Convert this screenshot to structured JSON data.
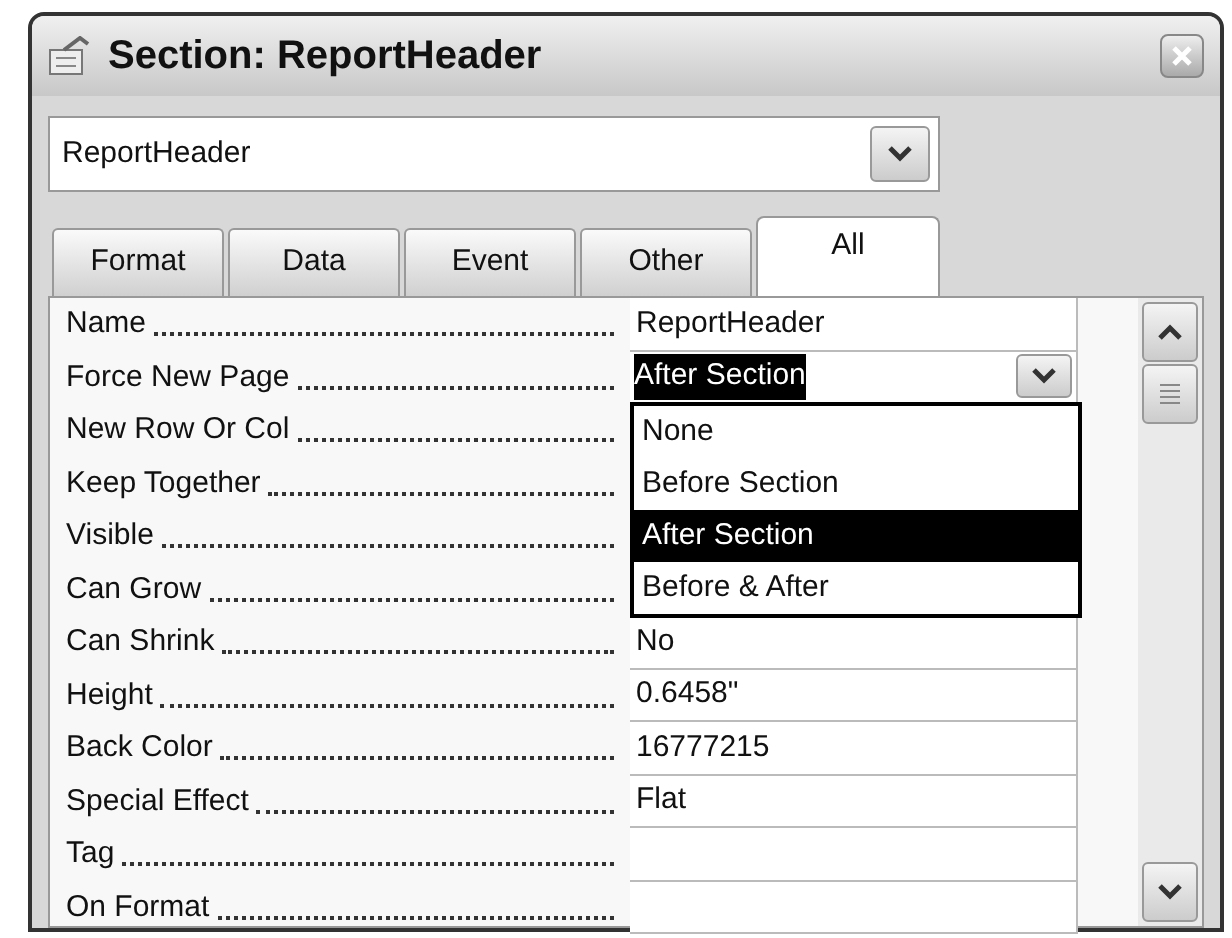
{
  "window": {
    "title": "Section: ReportHeader"
  },
  "object_selector": {
    "value": "ReportHeader"
  },
  "tabs": [
    {
      "label": "Format",
      "selected": false
    },
    {
      "label": "Data",
      "selected": false
    },
    {
      "label": "Event",
      "selected": false
    },
    {
      "label": "Other",
      "selected": false
    },
    {
      "label": "All",
      "selected": true
    }
  ],
  "properties": [
    {
      "label": "Name",
      "kind": "text",
      "value": "ReportHeader"
    },
    {
      "label": "Force New Page",
      "kind": "dropdown",
      "value": "After Section",
      "options": [
        {
          "label": "None",
          "selected": false
        },
        {
          "label": "Before Section",
          "selected": false
        },
        {
          "label": "After Section",
          "selected": true
        },
        {
          "label": "Before & After",
          "selected": false
        }
      ]
    },
    {
      "label": "New Row Or Col",
      "kind": "covered"
    },
    {
      "label": "Keep Together",
      "kind": "covered"
    },
    {
      "label": "Visible",
      "kind": "covered"
    },
    {
      "label": "Can Grow",
      "kind": "covered"
    },
    {
      "label": "Can Shrink",
      "kind": "text",
      "value": "No"
    },
    {
      "label": "Height",
      "kind": "text",
      "value": "0.6458\""
    },
    {
      "label": "Back Color",
      "kind": "text",
      "value": "16777215"
    },
    {
      "label": "Special Effect",
      "kind": "text",
      "value": "Flat"
    },
    {
      "label": "Tag",
      "kind": "text"
    },
    {
      "label": "On Format",
      "kind": "text"
    }
  ]
}
